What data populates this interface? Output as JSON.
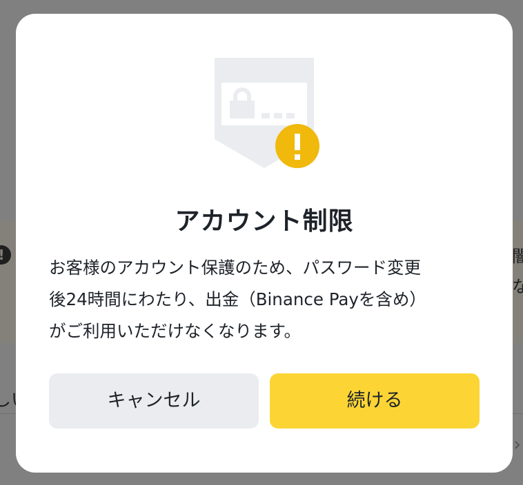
{
  "background": {
    "right_text_1": "闇",
    "right_text_2": "な",
    "left_text": "しい"
  },
  "modal": {
    "title": "アカウント制限",
    "message_lines": [
      "お客様のアカウント保護のため、パスワード変更",
      "後24時間にわたり、出金（Binance Payを含め）",
      "がご利用いただけなくなります。"
    ],
    "cancel_label": "キャンセル",
    "continue_label": "続ける"
  },
  "colors": {
    "primary_yellow": "#FCD535",
    "warning_badge": "#F0B90B",
    "secondary_gray": "#EAECEF",
    "text_dark": "#1E2329"
  },
  "icons": {
    "illustration": "lock-warning-icon"
  }
}
